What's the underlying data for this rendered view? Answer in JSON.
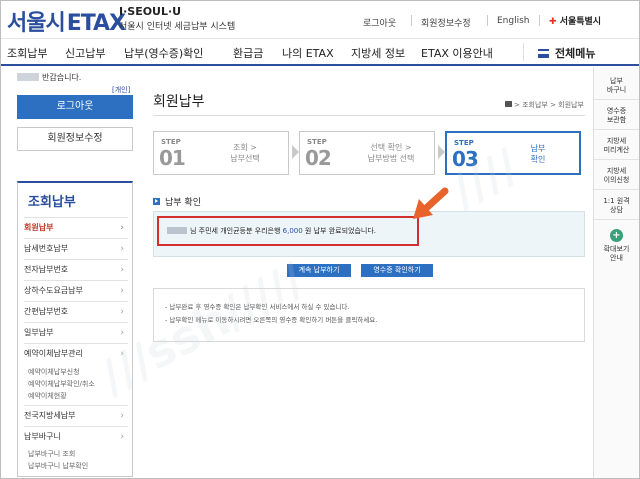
{
  "header": {
    "logo_seoul": "서울시",
    "logo_etax": "ETAX",
    "slogan": "I·SEOUL·U",
    "subtitle": "서울시 인터넷 세금납부 시스템",
    "util_links": [
      "로그아웃",
      "회원정보수정",
      "English"
    ],
    "city_logo": "서울특별시"
  },
  "gnb": {
    "items": [
      "조회납부",
      "신고납부",
      "납부(영수증)확인",
      "환급금",
      "나의 ETAX",
      "지방세 정보",
      "ETAX 이용안내"
    ],
    "all_menu": "전체메뉴"
  },
  "left": {
    "greeting": "반갑습니다.",
    "change_link": "[개인]",
    "logout_button": "로그아웃",
    "userinfo_button": "회원정보수정",
    "lnb_title": "조회납부",
    "lnb_items": [
      {
        "label": "회원납부"
      },
      {
        "label": "납세번호납부"
      },
      {
        "label": "전자납부번호"
      },
      {
        "label": "상하수도요금납부"
      },
      {
        "label": "간편납부번호"
      },
      {
        "label": "일부납부"
      },
      {
        "label": "예약이체납부관리"
      }
    ],
    "sub_items_reserve": [
      "예약이체납부신청",
      "예약이체납부확인/취소",
      "예약이체현황"
    ],
    "lnb_items_2": [
      {
        "label": "전국지방세납부"
      },
      {
        "label": "납부바구니"
      }
    ],
    "sub_items_basket": [
      "납부바구니 조회",
      "납부바구니 납부확인"
    ]
  },
  "content": {
    "page_title": "회원납부",
    "breadcrumb": "> 조회납부 > 회원납부",
    "steps": [
      {
        "label": "STEP",
        "num": "01",
        "desc1": "조회 >",
        "desc2": "납부선택"
      },
      {
        "label": "STEP",
        "num": "02",
        "desc1": "선택 확인 >",
        "desc2": "납부방법 선택"
      },
      {
        "label": "STEP",
        "num": "03",
        "desc1": "납부",
        "desc2": "확인"
      }
    ],
    "section_title": "납부 확인",
    "result_prefix": "님 주민세 개인균등분 우리은행",
    "result_amount": "6,000",
    "result_suffix": "원 납부 완료되었습니다.",
    "continue_button": "계속 납부하기",
    "receipt_button": "영수증 확인하기",
    "notices": [
      "- 납부완료 후 영수증 확인은 납부확인 서비스에서 하실 수 있습니다.",
      "- 납부확인 메뉴로 이동하시려면 오른쪽의 영수증 확인하기 버튼을 클릭하세요."
    ]
  },
  "right": {
    "items": [
      {
        "l1": "납부",
        "l2": "바구니"
      },
      {
        "l1": "영수증",
        "l2": "보관함"
      },
      {
        "l1": "지방세",
        "l2": "미리계산"
      },
      {
        "l1": "지방세",
        "l2": "이의신청"
      },
      {
        "l1": "1:1 원격",
        "l2": "상담"
      }
    ],
    "expand": {
      "l1": "확대보기",
      "l2": "안내"
    }
  },
  "colors": {
    "brand": "#2b4f9e",
    "button": "#2d6fc1",
    "highlight": "#d32f2f",
    "arrow": "#e8622c"
  }
}
